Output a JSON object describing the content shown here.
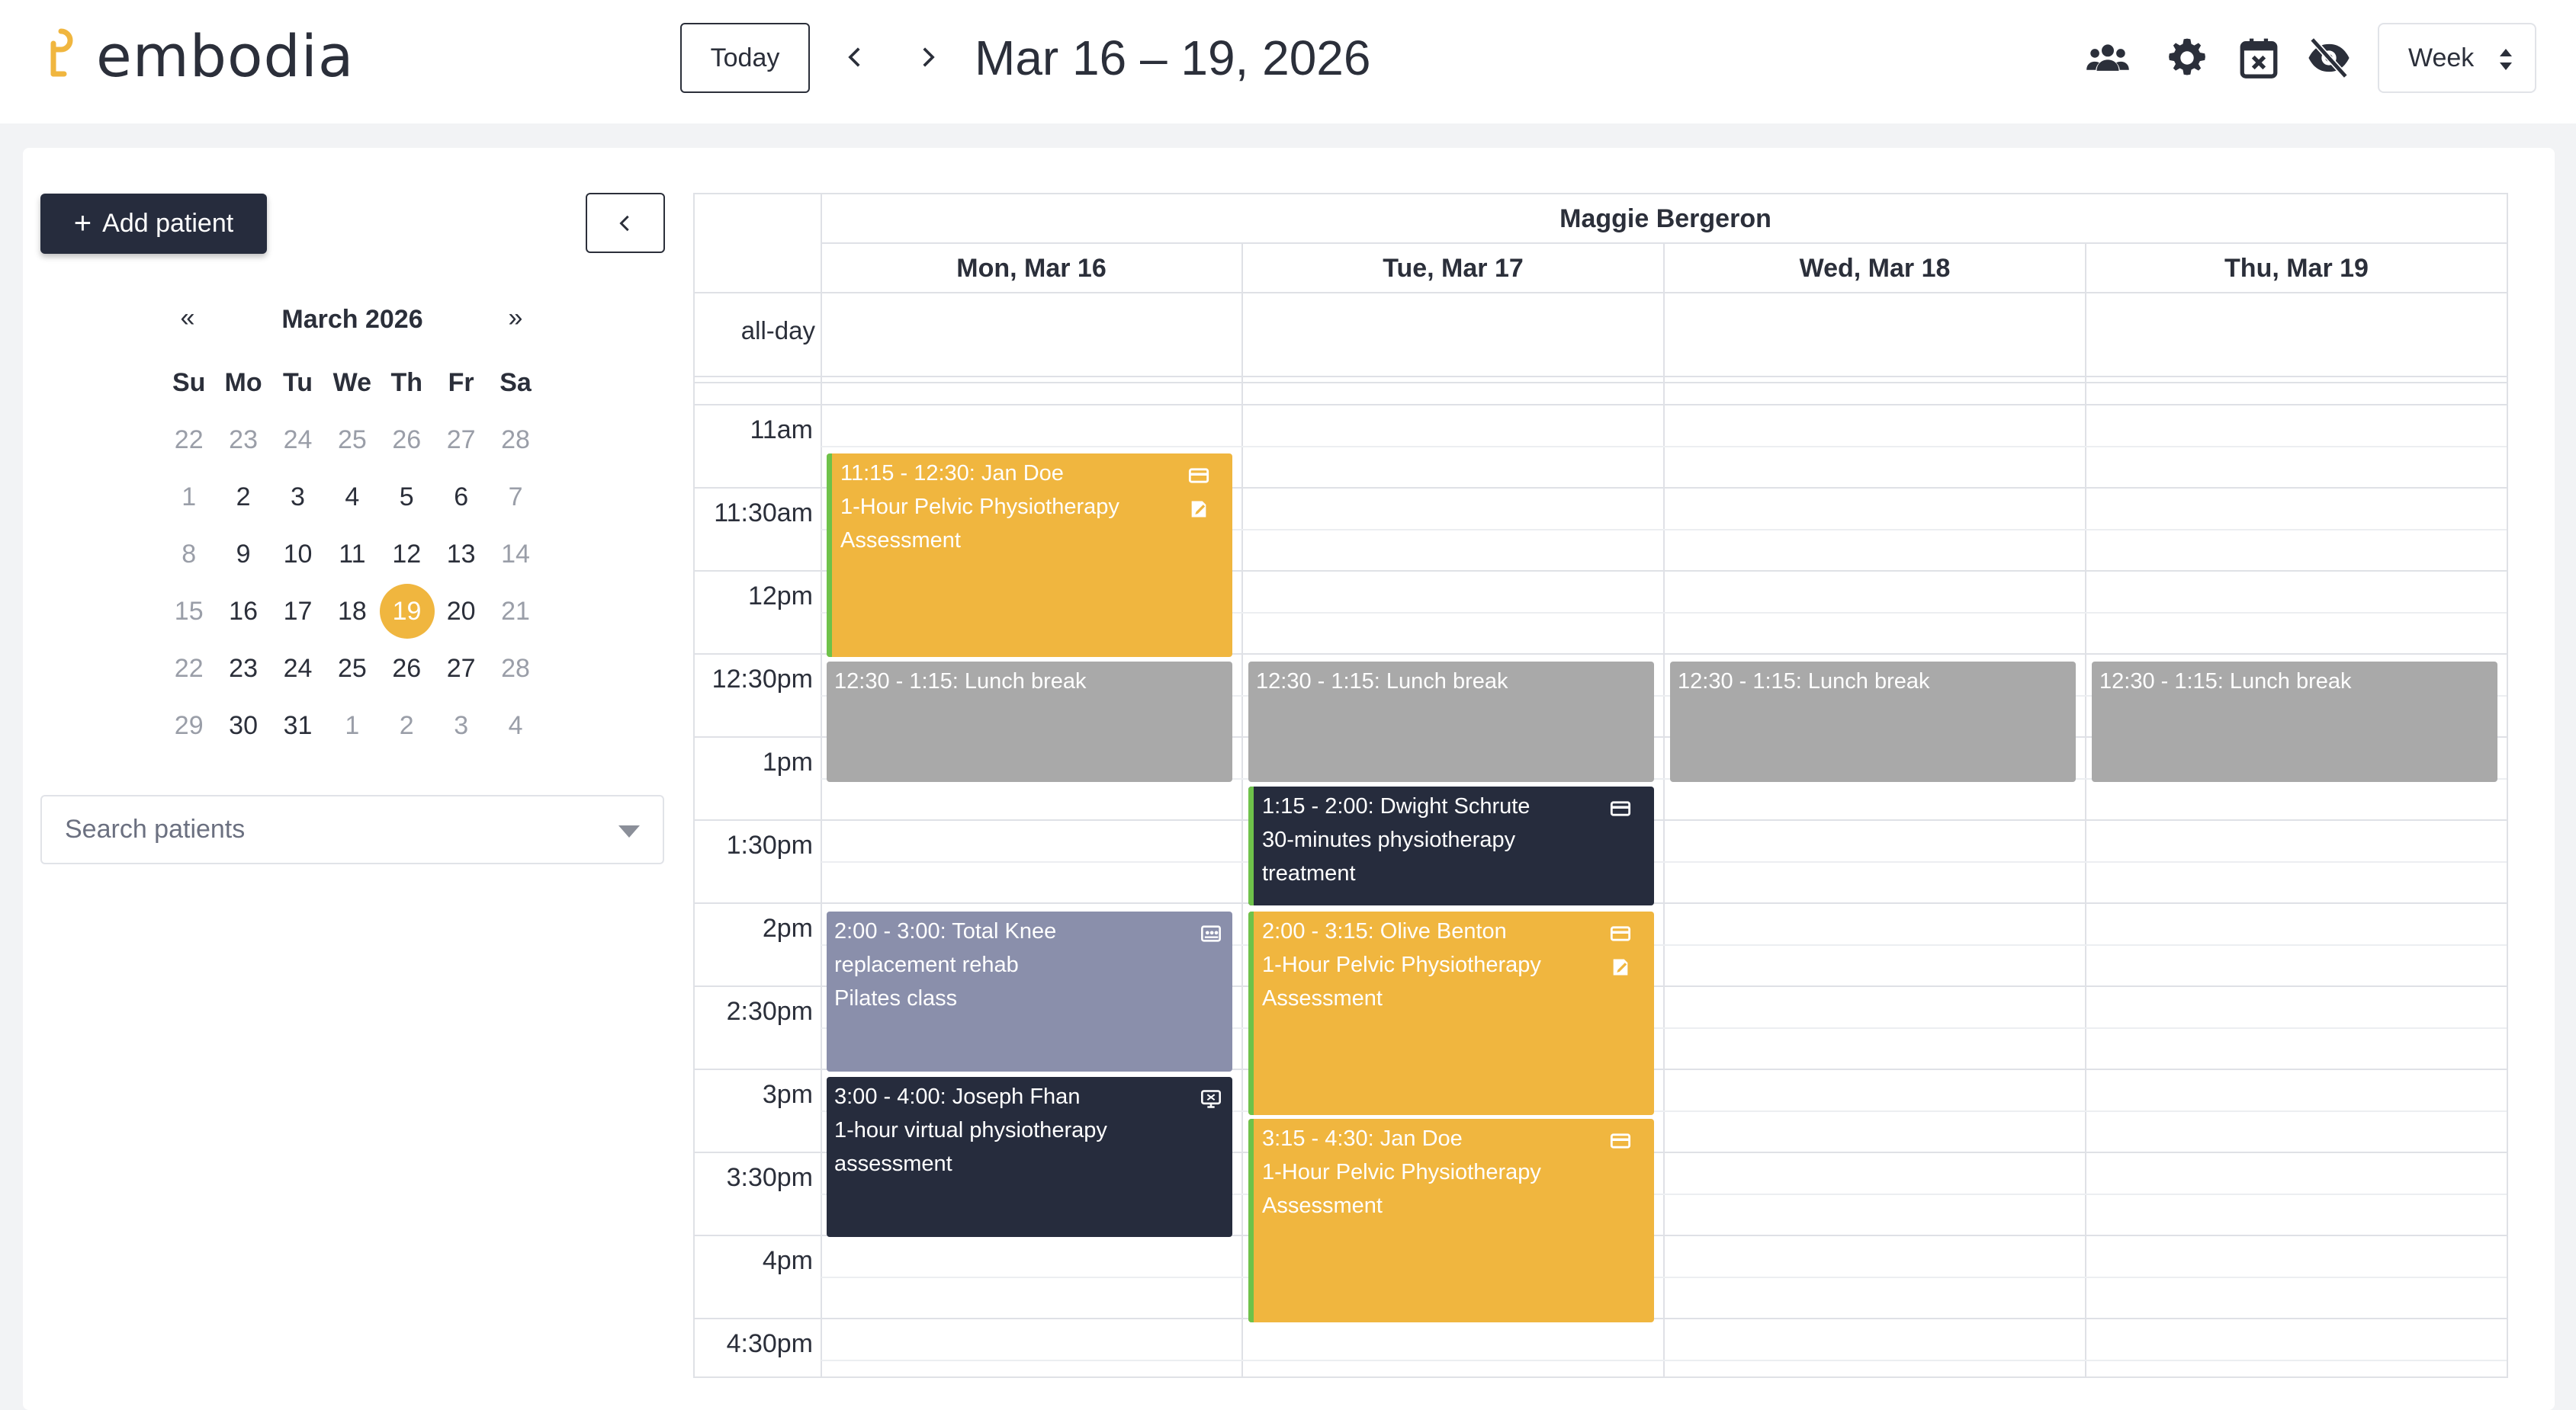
{
  "brand": {
    "name": "embodia"
  },
  "header": {
    "today_label": "Today",
    "range_title": "Mar 16 – 19, 2026",
    "view_select": "Week",
    "icons": [
      "users-icon",
      "gear-icon",
      "calendar-x-icon",
      "eye-off-icon"
    ]
  },
  "sidebar": {
    "add_patient_label": "Add patient",
    "mini_calendar": {
      "prev": "«",
      "next": "»",
      "title": "March 2026",
      "days_of_week": [
        "Su",
        "Mo",
        "Tu",
        "We",
        "Th",
        "Fr",
        "Sa"
      ],
      "weeks": [
        [
          "22",
          "23",
          "24",
          "25",
          "26",
          "27",
          "28"
        ],
        [
          "1",
          "2",
          "3",
          "4",
          "5",
          "6",
          "7"
        ],
        [
          "8",
          "9",
          "10",
          "11",
          "12",
          "13",
          "14"
        ],
        [
          "15",
          "16",
          "17",
          "18",
          "19",
          "20",
          "21"
        ],
        [
          "22",
          "23",
          "24",
          "25",
          "26",
          "27",
          "28"
        ],
        [
          "29",
          "30",
          "31",
          "1",
          "2",
          "3",
          "4"
        ]
      ],
      "selected": "19"
    },
    "search_placeholder": "Search patients"
  },
  "calendar": {
    "resource": "Maggie Bergeron",
    "days": [
      "Mon, Mar 16",
      "Tue, Mar 17",
      "Wed, Mar 18",
      "Thu, Mar 19"
    ],
    "allday_label": "all-day",
    "times": [
      "11am",
      "11:30am",
      "12pm",
      "12:30pm",
      "1pm",
      "1:30pm",
      "2pm",
      "2:30pm",
      "3pm",
      "3:30pm",
      "4pm",
      "4:30pm"
    ],
    "events": [
      {
        "lines": [
          "11:15 - 12:30: Jan Doe",
          "1-Hour Pelvic Physiotherapy",
          "Assessment"
        ]
      },
      {
        "lines": [
          "12:30 - 1:15: Lunch break"
        ]
      },
      {
        "lines": [
          "12:30 - 1:15: Lunch break"
        ]
      },
      {
        "lines": [
          "12:30 - 1:15: Lunch break"
        ]
      },
      {
        "lines": [
          "12:30 - 1:15: Lunch break"
        ]
      },
      {
        "lines": [
          "1:15 - 2:00: Dwight Schrute",
          "30-minutes physiotherapy",
          "treatment"
        ]
      },
      {
        "lines": [
          "2:00 - 3:00: Total Knee",
          "replacement rehab",
          "Pilates class"
        ]
      },
      {
        "lines": [
          "2:00 - 3:15: Olive Benton",
          "1-Hour Pelvic Physiotherapy",
          "Assessment"
        ]
      },
      {
        "lines": [
          "3:00 - 4:00: Joseph Fhan",
          "1-hour virtual physiotherapy",
          "assessment"
        ]
      },
      {
        "lines": [
          "3:15 - 4:30: Jan Doe",
          "1-Hour Pelvic Physiotherapy",
          "Assessment"
        ]
      }
    ]
  },
  "colors": {
    "accent_yellow": "#f0b63f",
    "navy": "#262c3d",
    "lunch_gray": "#a9a9a9",
    "class_slate": "#8a8fab",
    "status_green": "#6ec24a"
  }
}
